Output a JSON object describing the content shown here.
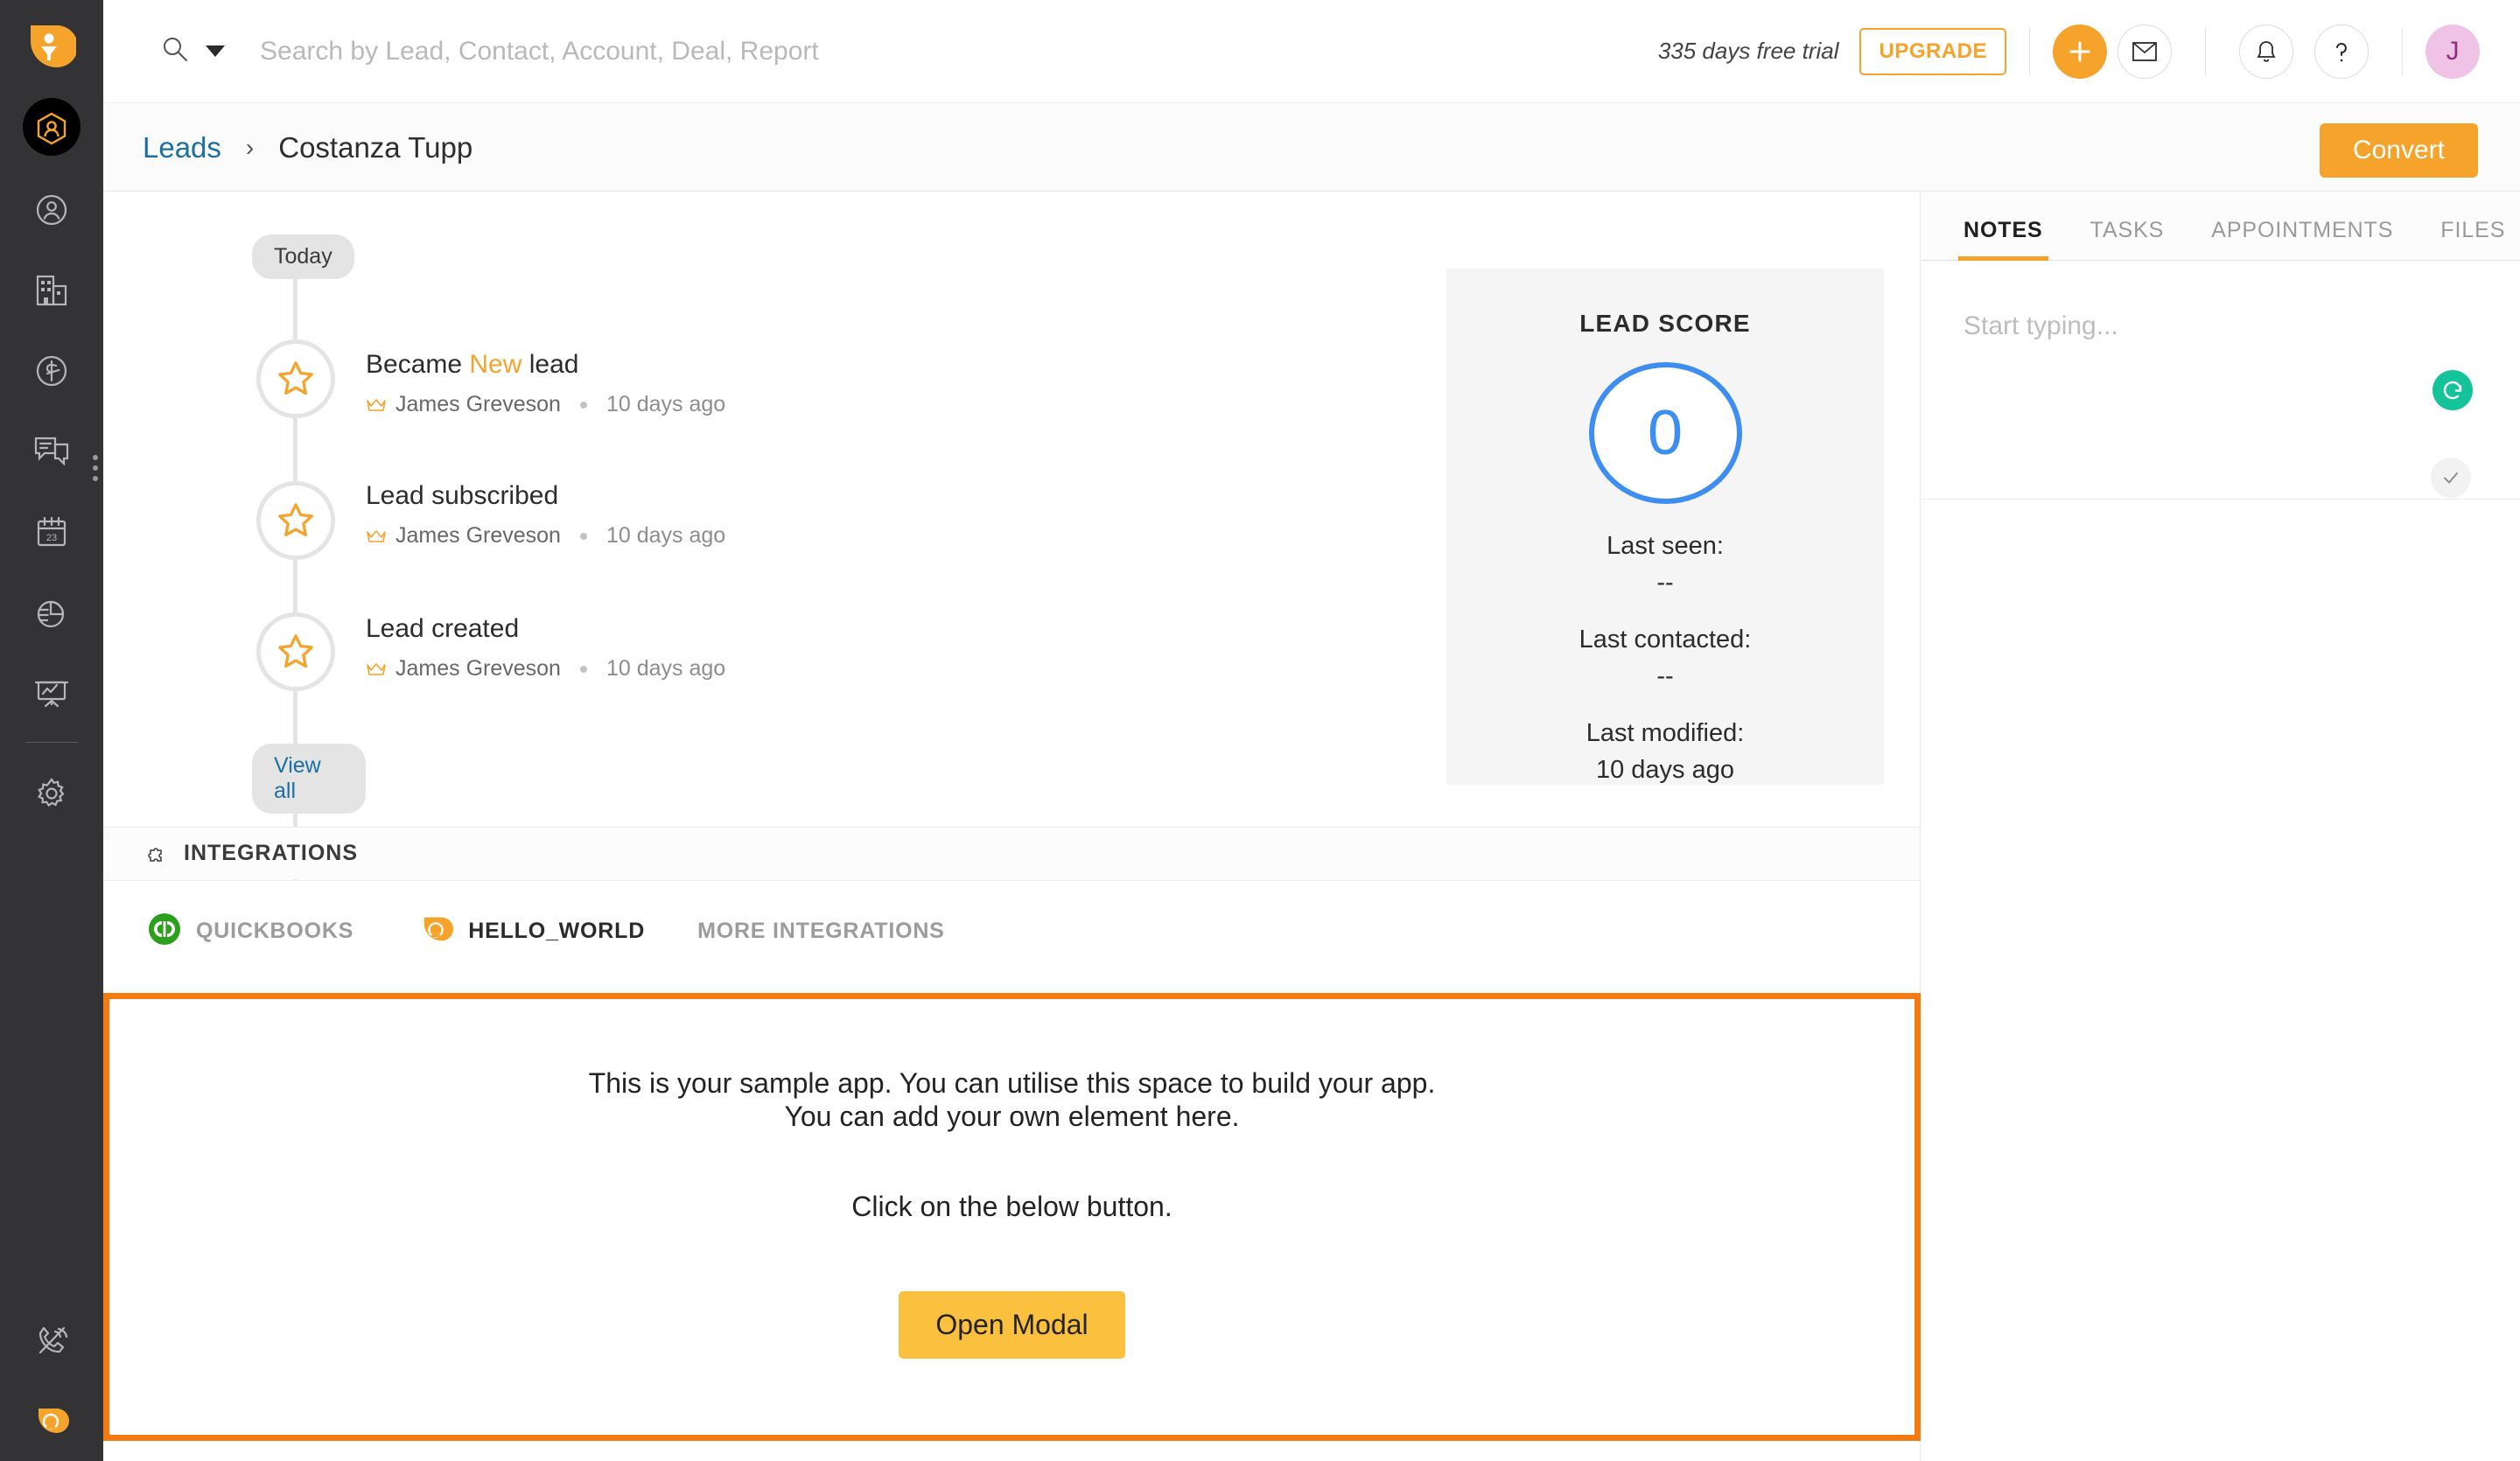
{
  "rail": {
    "logo_icon": "freshsales-funnel-logo",
    "items": [
      {
        "icon": "leads-person-hexagon-icon",
        "name": "leads",
        "active": true
      },
      {
        "icon": "contacts-person-circle-icon",
        "name": "contacts",
        "active": false
      },
      {
        "icon": "accounts-building-icon",
        "name": "accounts",
        "active": false
      },
      {
        "icon": "deals-dollar-circle-icon",
        "name": "deals",
        "active": false
      },
      {
        "icon": "conversations-chat-icon",
        "name": "conversations",
        "active": false
      },
      {
        "icon": "calendar-23-icon",
        "name": "calendar",
        "active": false
      },
      {
        "icon": "reports-pie-chart-icon",
        "name": "reports",
        "active": false
      },
      {
        "icon": "analytics-presentation-icon",
        "name": "analytics",
        "active": false
      },
      {
        "icon": "settings-gear-icon",
        "name": "settings",
        "active": false
      }
    ],
    "overflow_icon": "three-dots-vertical-icon",
    "bottom_items": [
      {
        "icon": "phone-off-icon",
        "name": "phone"
      },
      {
        "icon": "hello-world-app-icon",
        "name": "hello-world-app"
      }
    ]
  },
  "topbar": {
    "search_icon": "search-icon",
    "search_caret_icon": "chevron-down-icon",
    "search_value": "",
    "search_placeholder": "Search by Lead, Contact, Account, Deal, Report",
    "trial_text": "335 days free trial",
    "upgrade_label": "UPGRADE",
    "plus_icon": "plus-icon",
    "mail_icon": "envelope-icon",
    "bell_icon": "bell-icon",
    "help_icon": "question-mark-icon",
    "avatar_initial": "J"
  },
  "breadcrumb": {
    "parent": "Leads",
    "separator": "›",
    "current": "Costanza Tupp",
    "convert_label": "Convert"
  },
  "timeline": {
    "top_pill": "Today",
    "bottom_pill": "View all",
    "node_icon": "star-icon",
    "owner_icon": "crown-icon",
    "items": [
      {
        "title_pre": "Became ",
        "title_hl": "New",
        "title_post": " lead",
        "owner": "James Greveson",
        "when": "10 days ago"
      },
      {
        "title_pre": "Lead subscribed",
        "title_hl": "",
        "title_post": "",
        "owner": "James Greveson",
        "when": "10 days ago"
      },
      {
        "title_pre": "Lead created",
        "title_hl": "",
        "title_post": "",
        "owner": "James Greveson",
        "when": "10 days ago"
      }
    ]
  },
  "lead_score": {
    "title": "LEAD SCORE",
    "value": "0",
    "ring_color": "#3d8ef0",
    "rows": [
      {
        "label": "Last seen:",
        "value": "--"
      },
      {
        "label": "Last contacted:",
        "value": "--"
      },
      {
        "label": "Last modified:",
        "value": "10 days ago"
      }
    ]
  },
  "integrations": {
    "icon": "puzzle-piece-icon",
    "heading": "INTEGRATIONS",
    "chips": [
      {
        "icon": "quickbooks-icon",
        "label": "QUICKBOOKS",
        "color": "#9c9c9c"
      },
      {
        "icon": "hello-world-app-icon",
        "label": "HELLO_WORLD",
        "color": "#2b2b2b"
      }
    ],
    "more_label": "MORE INTEGRATIONS"
  },
  "sample_app": {
    "border_color": "#f47b12",
    "line1": "This is your sample app. You can utilise this space to build your app.",
    "line2": "You can add your own element here.",
    "line3": "Click on the below button.",
    "button_label": "Open Modal",
    "button_color": "#fbc13e"
  },
  "right_panel": {
    "tabs": [
      {
        "label": "NOTES",
        "active": true
      },
      {
        "label": "TASKS",
        "active": false
      },
      {
        "label": "APPOINTMENTS",
        "active": false
      },
      {
        "label": "FILES",
        "active": false
      }
    ],
    "note_value": "",
    "note_placeholder": "Start typing...",
    "grammarly_icon": "grammarly-icon",
    "grammarly_color": "#15c39a",
    "confirm_icon": "check-icon"
  }
}
